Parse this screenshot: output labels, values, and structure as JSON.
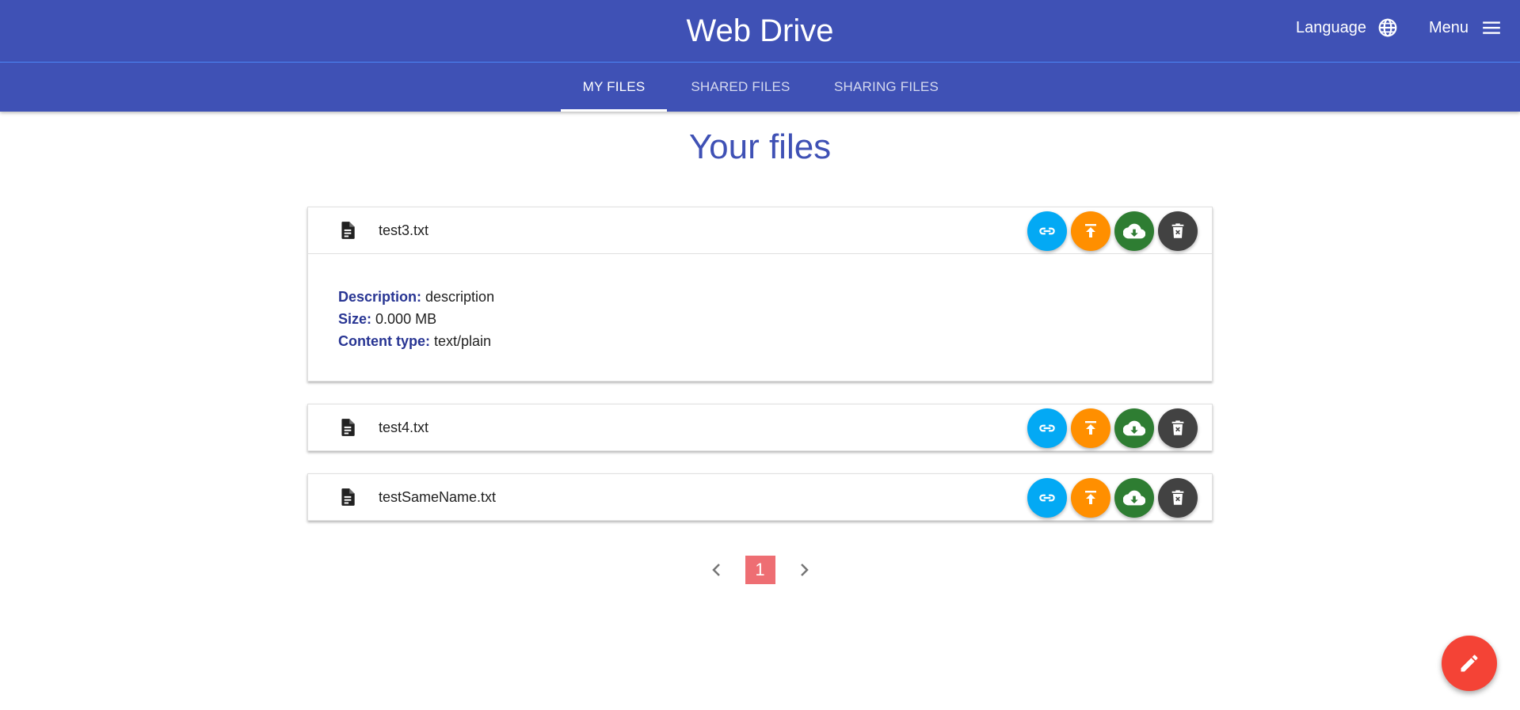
{
  "header": {
    "title": "Web Drive",
    "language_label": "Language",
    "menu_label": "Menu"
  },
  "tabs": [
    {
      "label": "MY FILES",
      "active": true
    },
    {
      "label": "SHARED FILES",
      "active": false
    },
    {
      "label": "SHARING FILES",
      "active": false
    }
  ],
  "page": {
    "heading": "Your files"
  },
  "files": [
    {
      "name": "test3.txt",
      "expanded": true,
      "details": {
        "description_label": "Description:",
        "description": "description",
        "size_label": "Size:",
        "size": "0.000 MB",
        "content_type_label": "Content type:",
        "content_type": "text/plain"
      }
    },
    {
      "name": "test4.txt",
      "expanded": false
    },
    {
      "name": "testSameName.txt",
      "expanded": false
    }
  ],
  "pagination": {
    "current_page": "1"
  },
  "colors": {
    "primary": "#3f51b5",
    "link_button": "#03a9f4",
    "upload_button": "#ff8f00",
    "download_button": "#2e7d32",
    "delete_button": "#424242",
    "active_page": "#ee6e73",
    "edit_fab": "#f44336"
  },
  "icons": {
    "language": "globe-icon",
    "menu": "hamburger-icon",
    "file": "document-icon",
    "link": "link-icon",
    "upload": "upload-icon",
    "download": "cloud-download-icon",
    "delete": "trash-icon",
    "prev": "chevron-left-icon",
    "next": "chevron-right-icon",
    "edit": "pencil-icon"
  }
}
